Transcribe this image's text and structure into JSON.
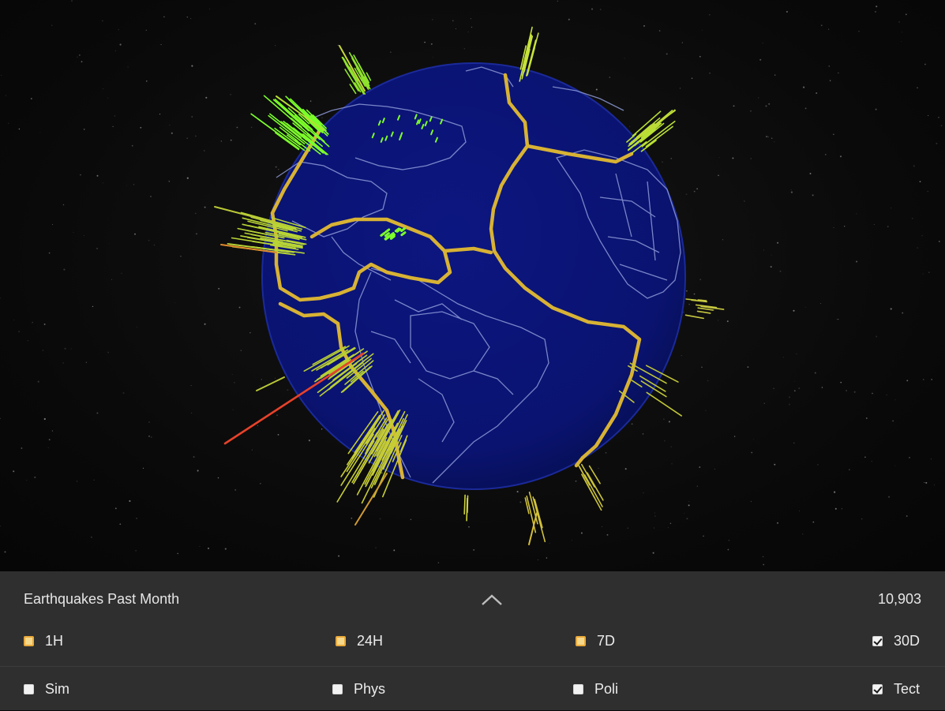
{
  "app": {
    "viewport": {
      "view": "3D globe — Atlantic hemisphere, earthquake bars over tectonic plate boundaries"
    },
    "colors": {
      "background": "#0b0b0b",
      "globe": "#0a1370",
      "borders": "#9aa6e6",
      "plate_boundaries": "#d8b234",
      "quake_shallow": "#7cff2a",
      "quake_medium": "#b7d732",
      "quake_deep": "#e7422a",
      "panel": "#2f2f2f",
      "panel_text": "#e8e8e8"
    }
  },
  "panel": {
    "title": "Earthquakes Past Month",
    "count": "10,903",
    "collapse_icon": "chevron-up-icon",
    "time_ranges": [
      {
        "label": "1H",
        "checked": false
      },
      {
        "label": "24H",
        "checked": false
      },
      {
        "label": "7D",
        "checked": false
      },
      {
        "label": "30D",
        "checked": true
      }
    ],
    "layers": [
      {
        "label": "Sim",
        "checked": false
      },
      {
        "label": "Phys",
        "checked": false
      },
      {
        "label": "Poli",
        "checked": false
      },
      {
        "label": "Tect",
        "checked": true
      }
    ]
  }
}
